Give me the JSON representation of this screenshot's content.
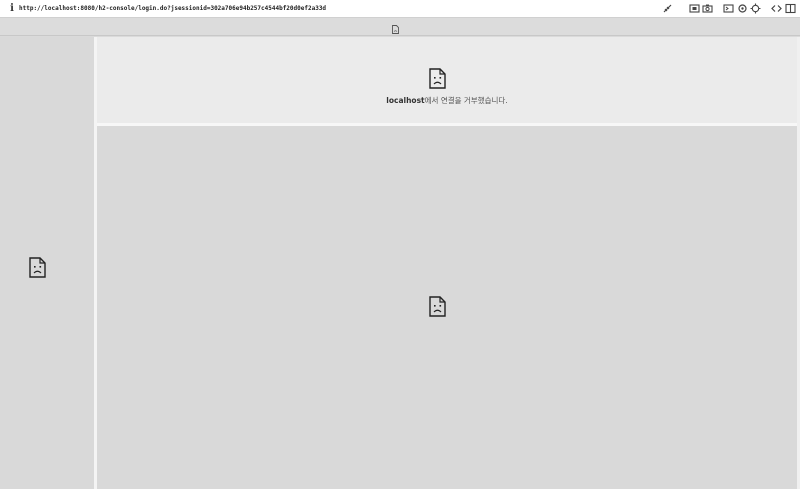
{
  "address_bar": {
    "info_icon": "info-icon",
    "info_glyph": "i",
    "url": "http://localhost:8080/h2-console/login.do?jsessionid=302a706e94b257c4544bf20d0ef2a33d"
  },
  "toolbar": {
    "icons": [
      "ruler-icon",
      "screenshot-icon",
      "camera-icon",
      "console-icon",
      "settings-icon",
      "responsive-icon",
      "code-icon",
      "sidebar-icon"
    ]
  },
  "document_strip": {
    "icon": "document-icon"
  },
  "top_frame": {
    "host": "localhost",
    "message": "에서 연결을 거부했습니다."
  },
  "frames": {
    "left_icon": "sad-document-icon",
    "top_icon": "sad-document-icon",
    "main_icon": "sad-document-icon"
  },
  "colors": {
    "frame_bg": "#d9d9d9",
    "top_frame_bg": "#ebebeb",
    "text": "#555555"
  }
}
